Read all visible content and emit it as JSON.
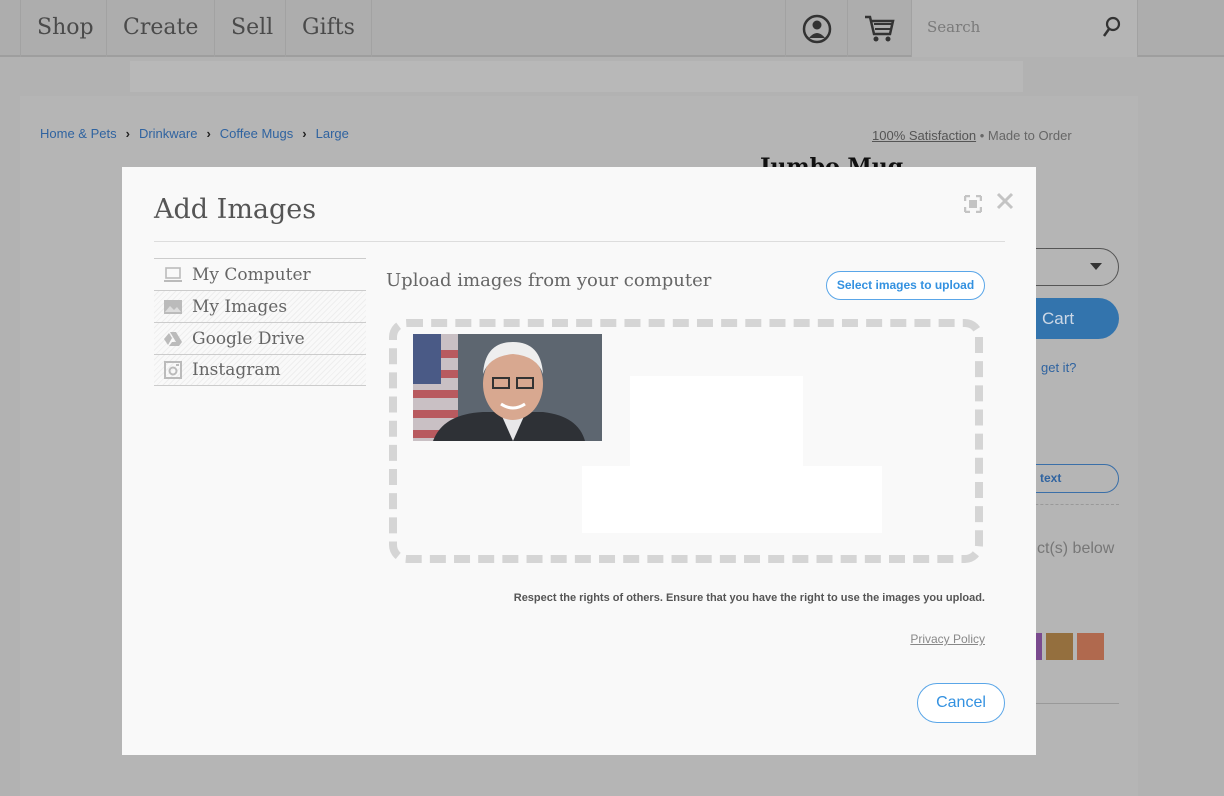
{
  "nav": {
    "items": [
      "Shop",
      "Create",
      "Sell",
      "Gifts"
    ],
    "search_placeholder": "Search",
    "icons": [
      "account-icon",
      "cart-icon",
      "search-icon"
    ]
  },
  "breadcrumb": [
    "Home & Pets",
    "Drinkware",
    "Coffee Mugs",
    "Large"
  ],
  "product": {
    "satisfaction": "100% Satisfaction",
    "made_to_order": "Made to Order",
    "title": "Jumbo Mug",
    "add_to_cart": "Cart",
    "get_it": "get it?",
    "add_text": "text",
    "select_below": "ct(s) below",
    "swatches": [
      "#7a4a8e",
      "#946f3e",
      "#b0694e"
    ]
  },
  "modal": {
    "title": "Add Images",
    "sources": [
      {
        "label": "My Computer",
        "icon": "computer-icon"
      },
      {
        "label": "My Images",
        "icon": "image-icon"
      },
      {
        "label": "Google Drive",
        "icon": "google-drive-icon"
      },
      {
        "label": "Instagram",
        "icon": "instagram-icon"
      }
    ],
    "upload_title": "Upload images from your computer",
    "select_button": "Select images to upload",
    "rights_notice": "Respect the rights of others. Ensure that you have the right to use the images you upload.",
    "privacy_link": "Privacy Policy",
    "cancel_button": "Cancel"
  },
  "colors": {
    "accent": "#3391e0",
    "cart_button": "#3374ad"
  }
}
